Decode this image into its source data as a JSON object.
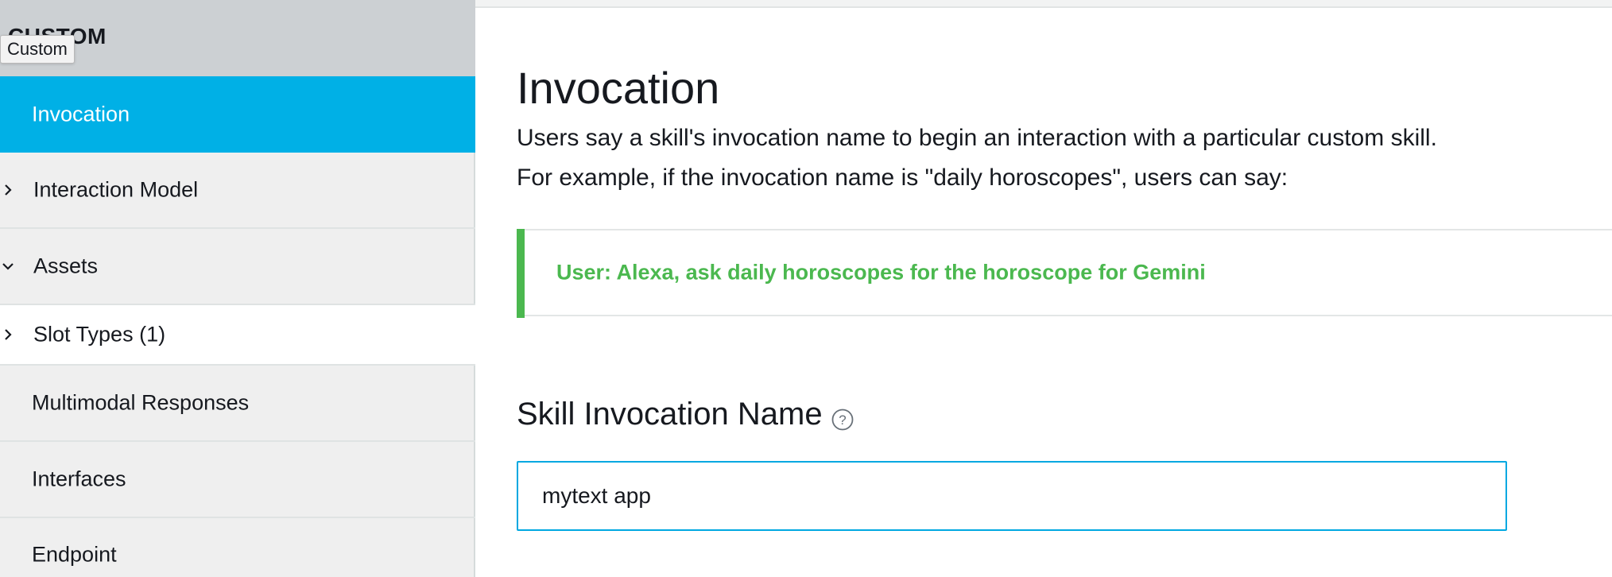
{
  "sidebar": {
    "header_title": "CUSTOM",
    "tooltip": "Custom",
    "items": [
      {
        "label": "Invocation"
      },
      {
        "label": "Interaction Model"
      },
      {
        "label": "Assets"
      },
      {
        "label": "Slot Types (1)"
      },
      {
        "label": "Multimodal Responses"
      },
      {
        "label": "Interfaces"
      },
      {
        "label": "Endpoint"
      }
    ]
  },
  "main": {
    "title": "Invocation",
    "description_line1": "Users say a skill's invocation name to begin an interaction with a particular custom skill.",
    "description_line2": "For example, if the invocation name is \"daily horoscopes\", users can say:",
    "example": "User: Alexa, ask daily horoscopes for the horoscope for Gemini",
    "section_title": "Skill Invocation Name",
    "invocation_name_value": "mytext app"
  },
  "colors": {
    "active_nav": "#00b0e6",
    "example_accent": "#4bb84f",
    "input_border": "#00a8e1"
  },
  "icons": {
    "collapsed": "chevron-right-icon",
    "expanded": "chevron-down-icon",
    "help": "help-circle-icon"
  }
}
